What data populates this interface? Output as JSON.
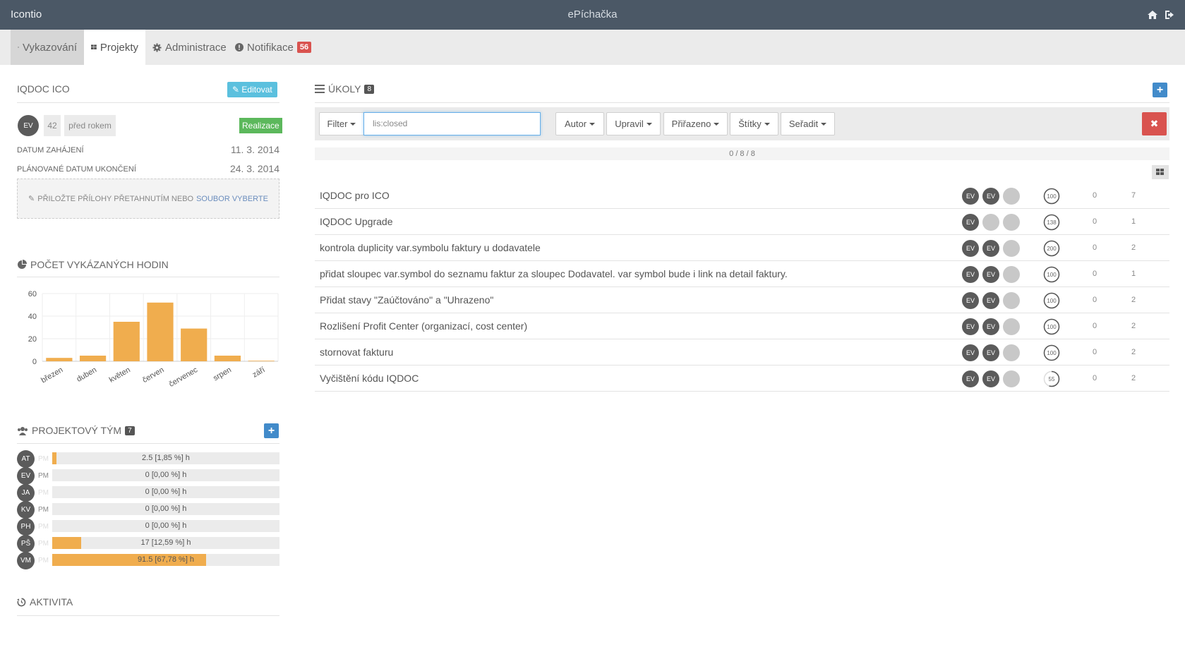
{
  "topbar": {
    "app_name": "Icontio",
    "title": "ePíchačka",
    "icons": [
      "home-icon",
      "sign-out-icon"
    ]
  },
  "nav": {
    "tabs": [
      {
        "label": "Vykazování",
        "icon": "clock-icon"
      },
      {
        "label": "Projekty",
        "icon": "grid-icon"
      },
      {
        "label": "Administrace",
        "icon": "gear-icon"
      },
      {
        "label": "Notifikace",
        "icon": "exclamation-icon",
        "badge": "56"
      }
    ]
  },
  "project": {
    "title": "IQDOC ICO",
    "edit_label": "Editovat",
    "owner_initials": "EV",
    "count": "42",
    "created": "před rokem",
    "status": "Realizace",
    "start_label": "DATUM ZAHÁJENÍ",
    "start_value": "11. 3. 2014",
    "end_label": "PLÁNOVANÉ DATUM UKONČENÍ",
    "end_value": "24. 3. 2014",
    "dropzone_text": "PŘILOŽTE PŘÍLOHY PŘETAHNUTÍM NEBO",
    "dropzone_link": "SOUBOR VYBERTE"
  },
  "hours": {
    "title": "POČET VYKÁZANÝCH HODIN"
  },
  "chart_data": {
    "type": "bar",
    "categories": [
      "březen",
      "duben",
      "květen",
      "červen",
      "červenec",
      "srpen",
      "září"
    ],
    "values": [
      3,
      5,
      35,
      52,
      29,
      5,
      0.5
    ],
    "ylim": [
      0,
      60
    ],
    "yticks": [
      "0",
      "20",
      "40",
      "60"
    ],
    "grid": true,
    "color": "#f0ad4e"
  },
  "team": {
    "title": "PROJEKTOVÝ TÝM",
    "count": "7",
    "members": [
      {
        "initials": "AT",
        "role": "PM",
        "active": false,
        "percent": 1.85,
        "text": "2.5 [1,85 %] h"
      },
      {
        "initials": "EV",
        "role": "PM",
        "active": true,
        "percent": 0,
        "text": "0 [0,00 %] h"
      },
      {
        "initials": "JA",
        "role": "PM",
        "active": false,
        "percent": 0,
        "text": "0 [0,00 %] h"
      },
      {
        "initials": "KV",
        "role": "PM",
        "active": true,
        "percent": 0,
        "text": "0 [0,00 %] h"
      },
      {
        "initials": "PH",
        "role": "PM",
        "active": false,
        "percent": 0,
        "text": "0 [0,00 %] h"
      },
      {
        "initials": "PŠ",
        "role": "PM",
        "active": false,
        "percent": 12.59,
        "text": "17 [12,59 %] h"
      },
      {
        "initials": "VM",
        "role": "PM",
        "active": false,
        "percent": 67.78,
        "text": "91.5 [67,78 %] h"
      }
    ]
  },
  "activity": {
    "title": "AKTIVITA"
  },
  "tasks": {
    "title": "ÚKOLY",
    "count": "8",
    "filter_label": "Filter",
    "filter_value": "lis:closed",
    "buttons": [
      "Autor",
      "Upravil",
      "Přiřazeno",
      "Štítky",
      "Seřadit"
    ],
    "counter": "0 / 8 / 8",
    "items": [
      {
        "name": "IQDOC pro ICO",
        "avatars": [
          "EV",
          "EV",
          ""
        ],
        "progress": "100",
        "pct": 100,
        "a": "0",
        "b": "7"
      },
      {
        "name": "IQDOC Upgrade",
        "avatars": [
          "EV",
          "",
          ""
        ],
        "progress": "138",
        "pct": 100,
        "a": "0",
        "b": "1"
      },
      {
        "name": "kontrola duplicity var.symbolu faktury u dodavatele",
        "avatars": [
          "EV",
          "EV",
          ""
        ],
        "progress": "200",
        "pct": 100,
        "a": "0",
        "b": "2"
      },
      {
        "name": "přidat sloupec var.symbol do seznamu faktur za sloupec Dodavatel. var symbol bude i link na detail faktury.",
        "avatars": [
          "EV",
          "EV",
          ""
        ],
        "progress": "100",
        "pct": 100,
        "a": "0",
        "b": "1"
      },
      {
        "name": "Přidat stavy \"Zaúčtováno\" a \"Uhrazeno\"",
        "avatars": [
          "EV",
          "EV",
          ""
        ],
        "progress": "100",
        "pct": 100,
        "a": "0",
        "b": "2"
      },
      {
        "name": "Rozlišení Profit Center (organizací, cost center)",
        "avatars": [
          "EV",
          "EV",
          ""
        ],
        "progress": "100",
        "pct": 100,
        "a": "0",
        "b": "2"
      },
      {
        "name": "stornovat fakturu",
        "avatars": [
          "EV",
          "EV",
          ""
        ],
        "progress": "100",
        "pct": 100,
        "a": "0",
        "b": "2"
      },
      {
        "name": "Vyčištění kódu IQDOC",
        "avatars": [
          "EV",
          "EV",
          ""
        ],
        "progress": "55",
        "pct": 55,
        "a": "0",
        "b": "2"
      }
    ]
  }
}
